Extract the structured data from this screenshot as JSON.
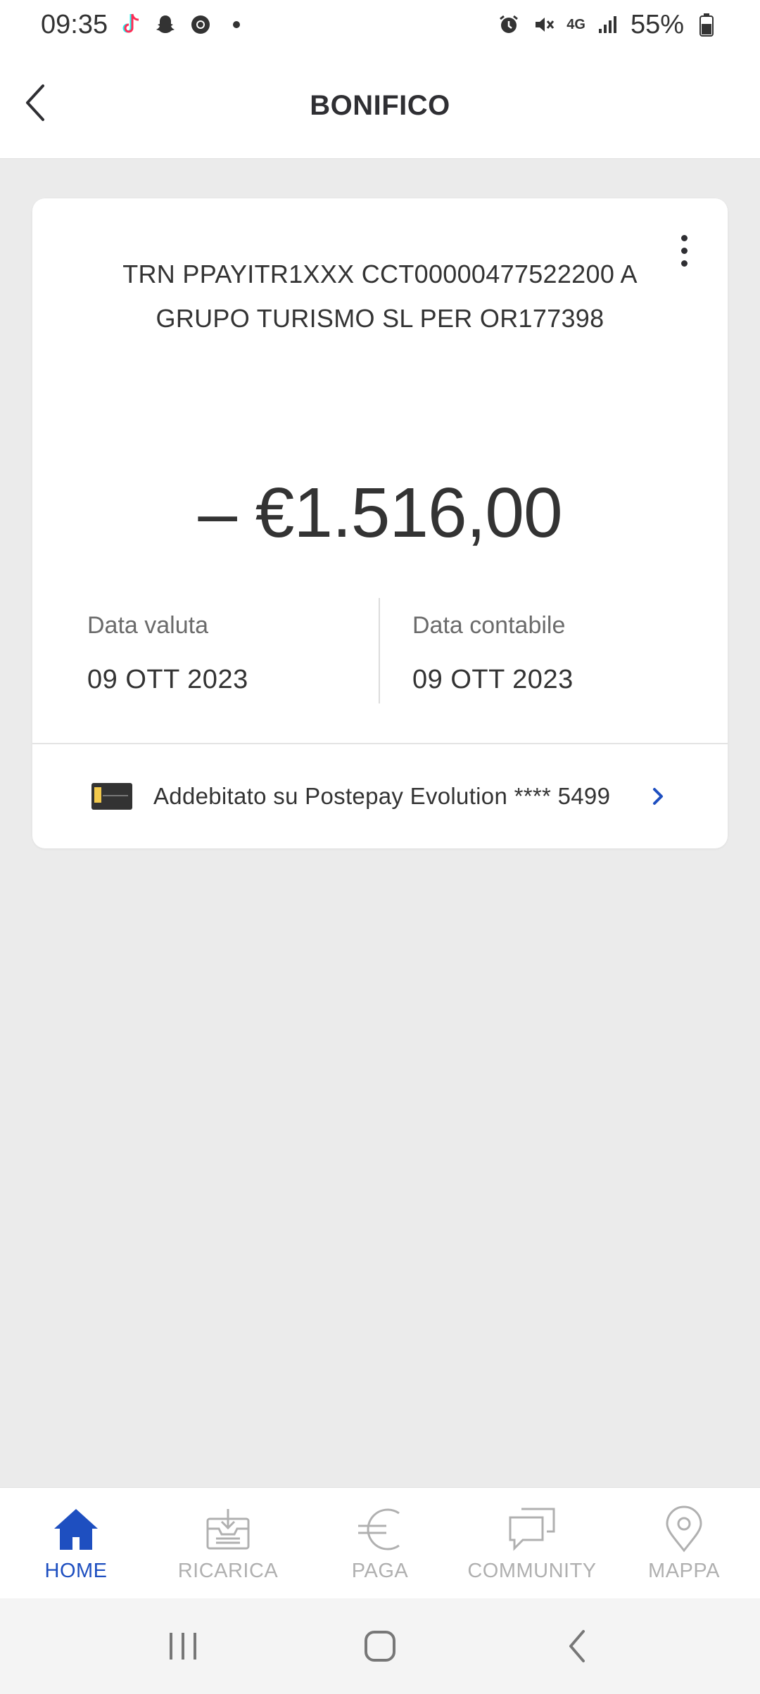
{
  "status_bar": {
    "time": "09:35",
    "battery": "55%",
    "network": "4G",
    "icons": [
      "tiktok-icon",
      "snapchat-icon",
      "chrome-icon",
      "alarm-icon",
      "mute-icon",
      "signal-icon",
      "battery-icon"
    ]
  },
  "header": {
    "title": "BONIFICO",
    "back_icon": "chevron-left-icon"
  },
  "transaction": {
    "description": "TRN PPAYITR1XXX CCT00000477522200 A GRUPO TURISMO SL PER OR177398",
    "amount": "– €1.516,00",
    "value_date_label": "Data valuta",
    "value_date": "09 OTT 2023",
    "accounting_date_label": "Data contabile",
    "accounting_date": "09 OTT 2023",
    "charged_to": "Addebitato su Postepay Evolution **** 5499",
    "more_icon": "more-vertical-icon"
  },
  "bottom_nav": {
    "items": [
      {
        "label": "HOME",
        "icon": "home-icon",
        "active": true
      },
      {
        "label": "RICARICA",
        "icon": "ricarica-icon",
        "active": false
      },
      {
        "label": "PAGA",
        "icon": "euro-icon",
        "active": false
      },
      {
        "label": "COMMUNITY",
        "icon": "chat-icon",
        "active": false
      },
      {
        "label": "MAPPA",
        "icon": "map-pin-icon",
        "active": false
      }
    ]
  },
  "colors": {
    "accent": "#1e4fc0",
    "background": "#ebebeb",
    "card": "#ffffff",
    "inactive": "#b0b0b0"
  }
}
